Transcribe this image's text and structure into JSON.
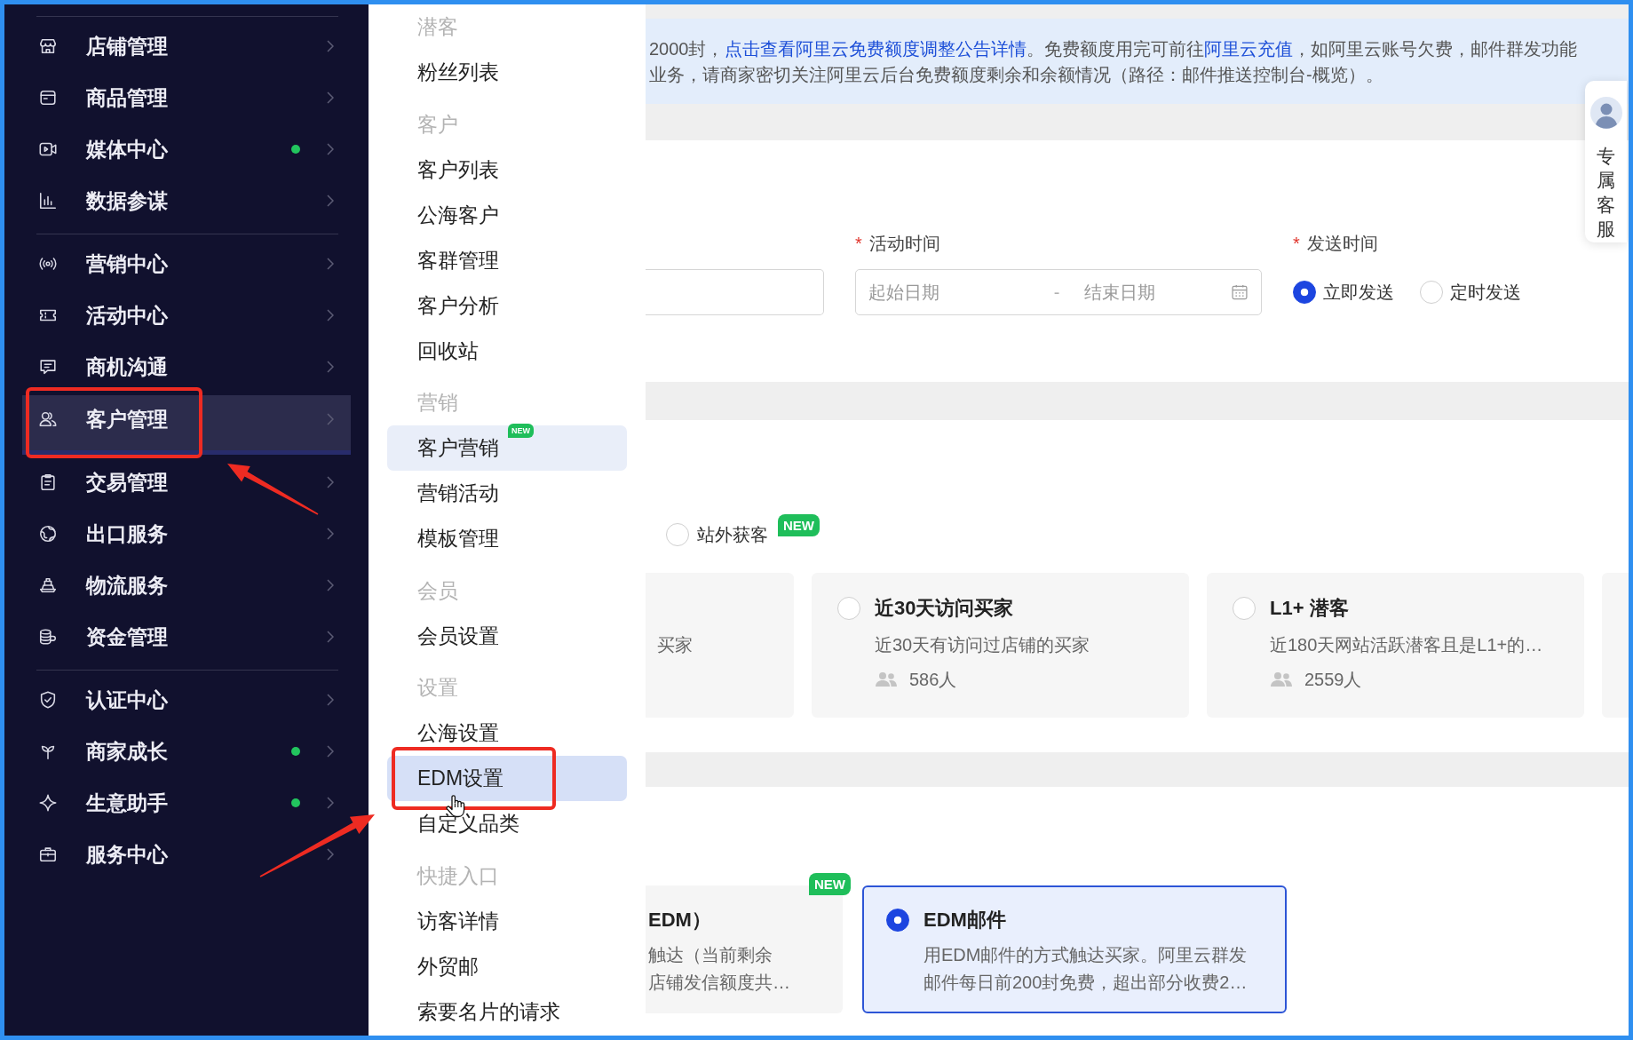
{
  "sidebar": {
    "groups": [
      {
        "items": [
          {
            "label": "店铺管理",
            "selected": false,
            "dot": false,
            "callout": false
          },
          {
            "label": "商品管理",
            "selected": false,
            "dot": false,
            "callout": false
          },
          {
            "label": "媒体中心",
            "selected": false,
            "dot": true,
            "callout": false
          },
          {
            "label": "数据参谋",
            "selected": false,
            "dot": false,
            "callout": false
          }
        ]
      },
      {
        "items": [
          {
            "label": "营销中心",
            "selected": false,
            "dot": false,
            "callout": false
          },
          {
            "label": "活动中心",
            "selected": false,
            "dot": false,
            "callout": false
          },
          {
            "label": "商机沟通",
            "selected": false,
            "dot": false,
            "callout": false
          },
          {
            "label": "客户管理",
            "selected": true,
            "dot": false,
            "callout": true
          },
          {
            "label": "交易管理",
            "selected": false,
            "dot": false,
            "callout": false
          },
          {
            "label": "出口服务",
            "selected": false,
            "dot": false,
            "callout": false
          },
          {
            "label": "物流服务",
            "selected": false,
            "dot": false,
            "callout": false
          },
          {
            "label": "资金管理",
            "selected": false,
            "dot": false,
            "callout": false
          }
        ]
      },
      {
        "items": [
          {
            "label": "认证中心",
            "selected": false,
            "dot": false,
            "callout": false
          },
          {
            "label": "商家成长",
            "selected": false,
            "dot": true,
            "callout": false
          },
          {
            "label": "生意助手",
            "selected": false,
            "dot": true,
            "callout": false
          },
          {
            "label": "服务中心",
            "selected": false,
            "dot": false,
            "callout": false
          }
        ]
      }
    ]
  },
  "submenu": {
    "groups": [
      {
        "title": "潜客",
        "items": [
          {
            "label": "粉丝列表",
            "selected": false,
            "hovered": false,
            "callout": false
          }
        ]
      },
      {
        "title": "客户",
        "items": [
          {
            "label": "客户列表",
            "selected": false,
            "hovered": false,
            "callout": false
          },
          {
            "label": "公海客户",
            "selected": false,
            "hovered": false,
            "callout": false
          },
          {
            "label": "客群管理",
            "selected": false,
            "hovered": false,
            "callout": false
          },
          {
            "label": "客户分析",
            "selected": false,
            "hovered": false,
            "callout": false
          },
          {
            "label": "回收站",
            "selected": false,
            "hovered": false,
            "callout": false
          }
        ]
      },
      {
        "title": "营销",
        "items": [
          {
            "label": "客户营销",
            "selected": true,
            "hovered": false,
            "callout": false,
            "badge": "NEW"
          },
          {
            "label": "营销活动",
            "selected": false,
            "hovered": false,
            "callout": false
          },
          {
            "label": "模板管理",
            "selected": false,
            "hovered": false,
            "callout": false
          }
        ]
      },
      {
        "title": "会员",
        "items": [
          {
            "label": "会员设置",
            "selected": false,
            "hovered": false,
            "callout": false
          }
        ]
      },
      {
        "title": "设置",
        "items": [
          {
            "label": "公海设置",
            "selected": false,
            "hovered": false,
            "callout": false
          },
          {
            "label": "EDM设置",
            "selected": false,
            "hovered": true,
            "callout": true
          },
          {
            "label": "自定义品类",
            "selected": false,
            "hovered": false,
            "callout": false
          }
        ]
      },
      {
        "title": "快捷入口",
        "items": [
          {
            "label": "访客详情",
            "selected": false,
            "hovered": false,
            "callout": false
          },
          {
            "label": "外贸邮",
            "selected": false,
            "hovered": false,
            "callout": false
          },
          {
            "label": "索要名片的请求",
            "selected": false,
            "hovered": false,
            "callout": false
          }
        ]
      }
    ]
  },
  "notice": {
    "lines": [
      [
        {
          "kind": "text",
          "text": "2000封，"
        },
        {
          "kind": "link",
          "text": "点击查看阿里云免费额度调整公告详情"
        },
        {
          "kind": "text",
          "text": "。免费额度用完可前往"
        },
        {
          "kind": "link",
          "text": "阿里云充值"
        },
        {
          "kind": "text",
          "text": "，如阿里云账号欠费，邮件群发功能"
        }
      ],
      [
        {
          "kind": "text",
          "text": "业务，请商家密切关注阿里云后台免费额度剩余和余额情况（路径：邮件推送控制台-概览）。"
        }
      ]
    ]
  },
  "form": {
    "fields": [
      {
        "kind": "text_input"
      },
      {
        "kind": "date_range",
        "required_mark": "*",
        "label": "活动时间",
        "start_placeholder": "起始日期",
        "separator": "-",
        "end_placeholder": "结束日期"
      },
      {
        "kind": "radio_group",
        "required_mark": "*",
        "label": "发送时间",
        "options": [
          {
            "label": "立即发送",
            "selected": true
          },
          {
            "label": "定时发送",
            "selected": false
          }
        ]
      }
    ]
  },
  "audience": {
    "sources": [
      {
        "label": "站外获客",
        "selected": false,
        "badge": "NEW"
      }
    ],
    "cards": [
      {
        "kind": "partial",
        "description": "买家"
      },
      {
        "kind": "full",
        "title": "近30天访问买家",
        "description": "近30天有访问过店铺的买家",
        "count": "586人",
        "selected": false
      },
      {
        "kind": "full",
        "title": "L1+ 潜客",
        "description": "近180天网站活跃潜客且是L1+的…",
        "count": "2559人",
        "selected": false
      },
      {
        "kind": "partial"
      }
    ]
  },
  "channels": {
    "cards": [
      {
        "kind": "partial",
        "title": "EDM）",
        "lines": [
          "触达（当前剩余",
          "店铺发信额度共…"
        ],
        "badge": "NEW"
      },
      {
        "kind": "full",
        "title": "EDM邮件",
        "lines": [
          "用EDM邮件的方式触达买家。阿里云群发",
          "邮件每日前200封免费，超出部分收费2…"
        ],
        "selected": true
      }
    ]
  },
  "support": {
    "label": "专属客服"
  }
}
